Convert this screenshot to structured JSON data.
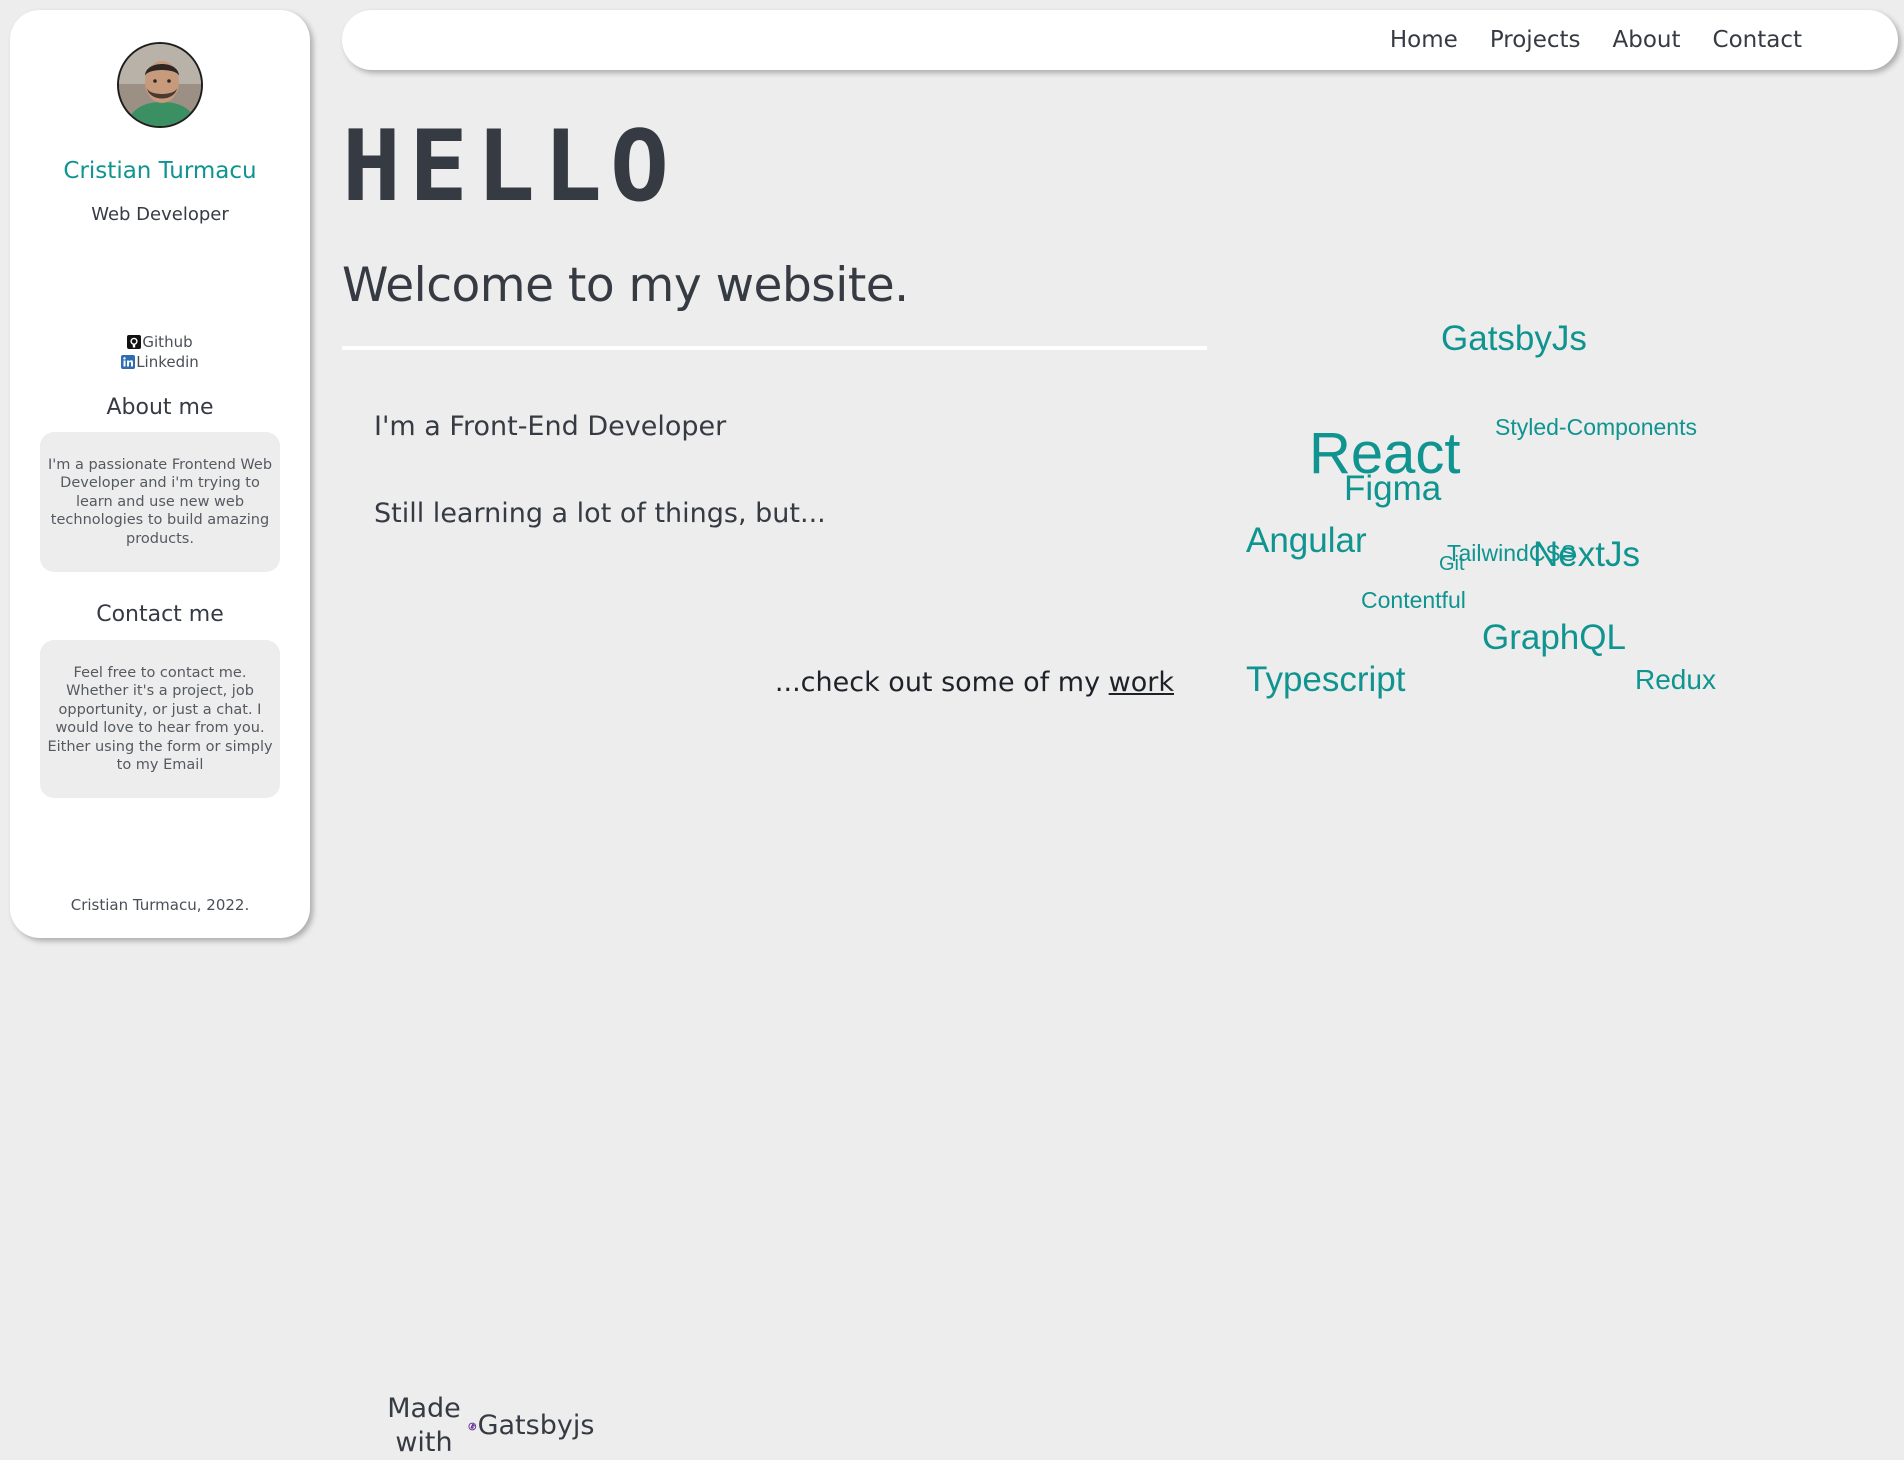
{
  "sidebar": {
    "name": "Cristian Turmacu",
    "role": "Web Developer",
    "social": {
      "github": "Github",
      "linkedin": "Linkedin"
    },
    "about": {
      "title": "About me",
      "text": "I'm a passionate Frontend Web Developer and i'm trying to learn and use new web technologies to build amazing products."
    },
    "contact": {
      "title": "Contact me",
      "text": "Feel free to contact me. Whether it's a project, job opportunity, or just a chat. I would love to hear from you. Either using the form or simply to my Email"
    },
    "footer": {
      "copyright": "Cristian Turmacu, 2022.",
      "made_with": "Made with",
      "framework": "Gatsbyjs"
    }
  },
  "nav": {
    "home": "Home",
    "projects": "Projects",
    "about": "About",
    "contact": "Contact"
  },
  "main": {
    "hello": "HELLO",
    "welcome": "Welcome to my website.",
    "line1": "I'm a Front-End Developer",
    "line2": "Still learning a lot of things, but...",
    "checkout_prefix": "...check out some of my ",
    "checkout_link": "work"
  },
  "skills": [
    "GatsbyJs",
    "Styled-Components",
    "React",
    "Figma",
    "Angular",
    "TailwindCSS",
    "NextJs",
    "Git",
    "Contentful",
    "GraphQL",
    "Typescript",
    "Redux"
  ],
  "colors": {
    "accent": "#0f9490",
    "text": "#363b43",
    "background": "#ededed",
    "panel": "#ffffff"
  },
  "icons": {
    "github": "github-icon",
    "linkedin": "linkedin-icon",
    "gatsby": "gatsby-icon"
  }
}
